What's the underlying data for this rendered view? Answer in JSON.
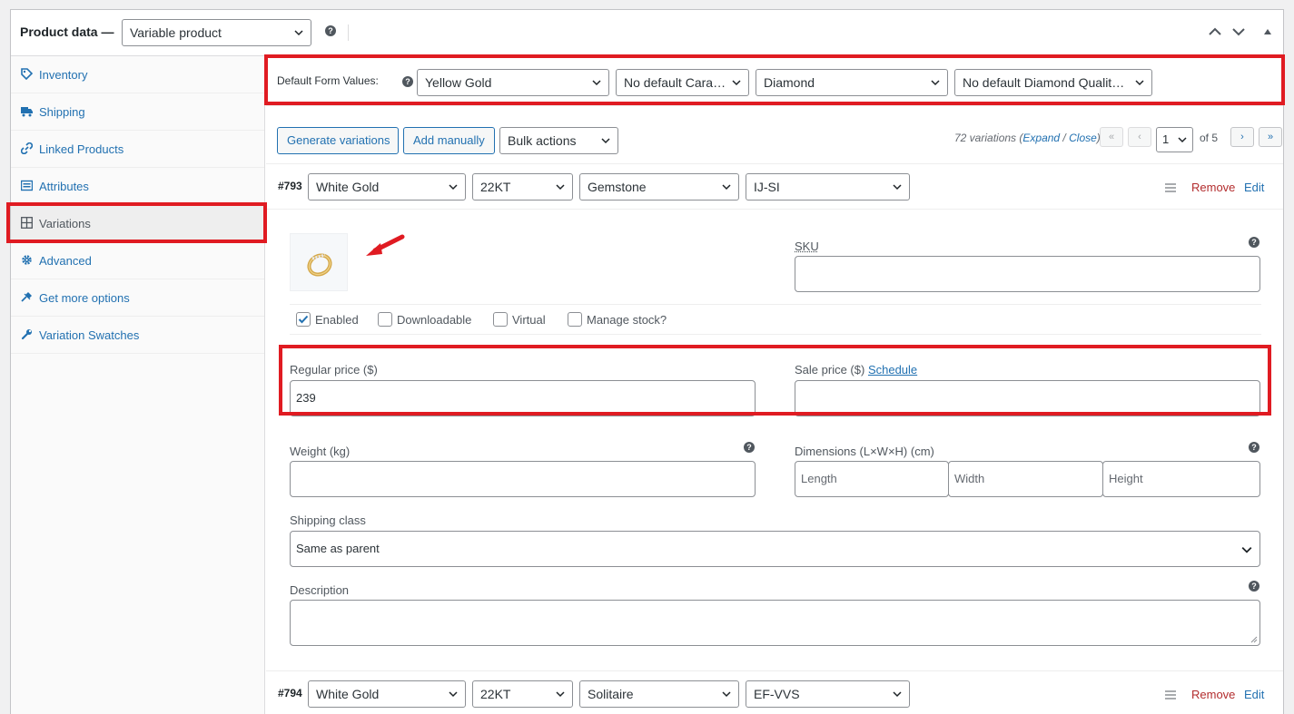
{
  "header": {
    "title": "Product data —",
    "product_type": "Variable product"
  },
  "sidebar": {
    "items": [
      {
        "label": "Inventory",
        "icon": "tag-icon"
      },
      {
        "label": "Shipping",
        "icon": "truck-icon"
      },
      {
        "label": "Linked Products",
        "icon": "link-icon"
      },
      {
        "label": "Attributes",
        "icon": "list-icon"
      },
      {
        "label": "Variations",
        "icon": "grid-icon"
      },
      {
        "label": "Advanced",
        "icon": "gear-icon"
      },
      {
        "label": "Get more options",
        "icon": "plugin-icon"
      },
      {
        "label": "Variation Swatches",
        "icon": "wrench-icon"
      }
    ],
    "active": "Variations"
  },
  "defaults": {
    "label": "Default Form Values:",
    "metal": "Yellow Gold",
    "carat": "No default Carat…",
    "stone": "Diamond",
    "quality": "No default Diamond Quality…"
  },
  "toolbar": {
    "generate": "Generate variations",
    "add_manually": "Add manually",
    "bulk_actions": "Bulk actions"
  },
  "pager": {
    "count": "72 variations",
    "expand": "Expand",
    "slash": " / ",
    "close": "Close",
    "first": "«",
    "prev": "‹",
    "page": "1",
    "of": "of 5",
    "next": "›",
    "last": "»"
  },
  "variation1": {
    "id": "#793",
    "metal": "White Gold",
    "carat": "22KT",
    "stone": "Gemstone",
    "quality": "IJ-SI",
    "remove": "Remove",
    "edit": "Edit",
    "sku_label": "SKU",
    "enabled": "Enabled",
    "downloadable": "Downloadable",
    "virtual": "Virtual",
    "manage_stock": "Manage stock?",
    "regular_price_label": "Regular price ($)",
    "regular_price": "239",
    "sale_price_label": "Sale price ($)",
    "schedule": "Schedule",
    "weight_label": "Weight (kg)",
    "dimensions_label": "Dimensions (L×W×H) (cm)",
    "length_ph": "Length",
    "width_ph": "Width",
    "height_ph": "Height",
    "shipping_class_label": "Shipping class",
    "shipping_class": "Same as parent",
    "description_label": "Description"
  },
  "variation2": {
    "id": "#794",
    "metal": "White Gold",
    "carat": "22KT",
    "stone": "Solitaire",
    "quality": "EF-VVS",
    "remove": "Remove",
    "edit": "Edit"
  },
  "colors": {
    "highlight": "#e01b22",
    "link": "#2271b1",
    "remove": "#b32d2e"
  }
}
